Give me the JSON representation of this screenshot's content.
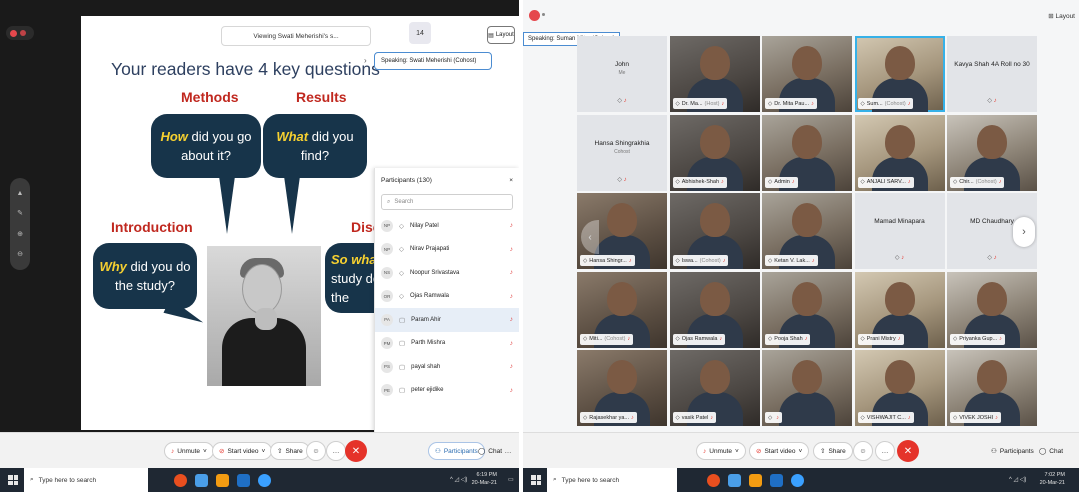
{
  "left": {
    "viewing_label": "Viewing Swati Meherishi's s...",
    "page_number": "14",
    "layout_label": "Layout",
    "slide": {
      "title": "Your readers have 4 key questions",
      "labels": {
        "methods": "Methods",
        "results": "Results",
        "introduction": "Introduction",
        "discussion": "Disc"
      },
      "bubbles": {
        "how_em": "How",
        "how_rest": " did you go about it?",
        "what_em": "What",
        "what_rest": " did you find?",
        "why_em": "Why",
        "why_rest": " did you do the study?",
        "so_em": "So what",
        "so_rest": "study do the"
      }
    },
    "speaking": "Speaking: Swati Meherishi (Cohost)",
    "participants": {
      "header": "Participants (130)",
      "search_placeholder": "Search",
      "rows": [
        {
          "initials": "NP",
          "name": "Nilay Patel"
        },
        {
          "initials": "NP",
          "name": "Nirav Prajapati"
        },
        {
          "initials": "NS",
          "name": "Noopur Srivastava"
        },
        {
          "initials": "OR",
          "name": "Ojas Ramwala"
        },
        {
          "initials": "PA",
          "name": "Param Ahir"
        },
        {
          "initials": "PM",
          "name": "Parth Mishra"
        },
        {
          "initials": "PS",
          "name": "payal shah"
        },
        {
          "initials": "PE",
          "name": "peter ejidike"
        }
      ]
    },
    "controls": {
      "unmute": "Unmute",
      "start_video": "Start video",
      "share": "Share",
      "participants": "Participants",
      "chat": "Chat"
    },
    "taskbar": {
      "search": "Type here to search",
      "time": "6:19 PM",
      "date": "20-Mar-21"
    }
  },
  "right": {
    "layout_label": "Layout",
    "speaking": "Speaking: Suman Mitra (Cohost)",
    "tiles": [
      {
        "label": "John",
        "sub": "Me",
        "kind": "placeholder"
      },
      {
        "label": "Dr. Ma...",
        "suffix": "(Host)",
        "kind": "video"
      },
      {
        "label": "Dr. Mita Pau...",
        "kind": "video"
      },
      {
        "label": "Sum...",
        "suffix": "(Cohost)",
        "kind": "video",
        "active": true
      },
      {
        "label": "Kavya Shah 4A Roll no 30",
        "kind": "placeholder"
      },
      {
        "label": "Hansa Shingrakhia",
        "sub": "Cohost",
        "kind": "placeholder"
      },
      {
        "label": "Abhishek-Shah",
        "kind": "video"
      },
      {
        "label": "Admin",
        "kind": "video"
      },
      {
        "label": "ANJALI SARV...",
        "kind": "video"
      },
      {
        "label": "Chir...",
        "suffix": "(Cohost)",
        "kind": "video"
      },
      {
        "label": "Hansa Shingr...",
        "kind": "video"
      },
      {
        "label": "Iswa...",
        "suffix": "(Cohost)",
        "kind": "video"
      },
      {
        "label": "Ketan V. Lak...",
        "kind": "video"
      },
      {
        "label": "Mamad Minapara",
        "kind": "placeholder"
      },
      {
        "label": "MD Chaudhary",
        "kind": "placeholder"
      },
      {
        "label": "Miti...",
        "suffix": "(Cohost)",
        "kind": "video"
      },
      {
        "label": "Ojas Ramwala",
        "kind": "video"
      },
      {
        "label": "Pooja Shah",
        "kind": "video"
      },
      {
        "label": "Prani Mistry",
        "kind": "video"
      },
      {
        "label": "Priyanka Gup...",
        "kind": "video"
      },
      {
        "label": "Rajasekhar ya...",
        "kind": "video"
      },
      {
        "label": "vasik Patel",
        "kind": "video"
      },
      {
        "label": "",
        "kind": "video"
      },
      {
        "label": "VISHWAJIT C...",
        "kind": "video"
      },
      {
        "label": "VIVEK JOSHI",
        "kind": "video"
      }
    ],
    "controls": {
      "unmute": "Unmute",
      "start_video": "Start video",
      "share": "Share",
      "participants": "Participants",
      "chat": "Chat"
    },
    "taskbar": {
      "search": "Type here to search",
      "time": "7:02 PM",
      "date": "20-Mar-21"
    }
  },
  "colors": {
    "accent": "#36b1e8",
    "leave": "#e5332a",
    "bubble": "#17344a",
    "highlight": "#f7d130",
    "slide_red": "#c0281f",
    "title_blue": "#2e4060"
  }
}
